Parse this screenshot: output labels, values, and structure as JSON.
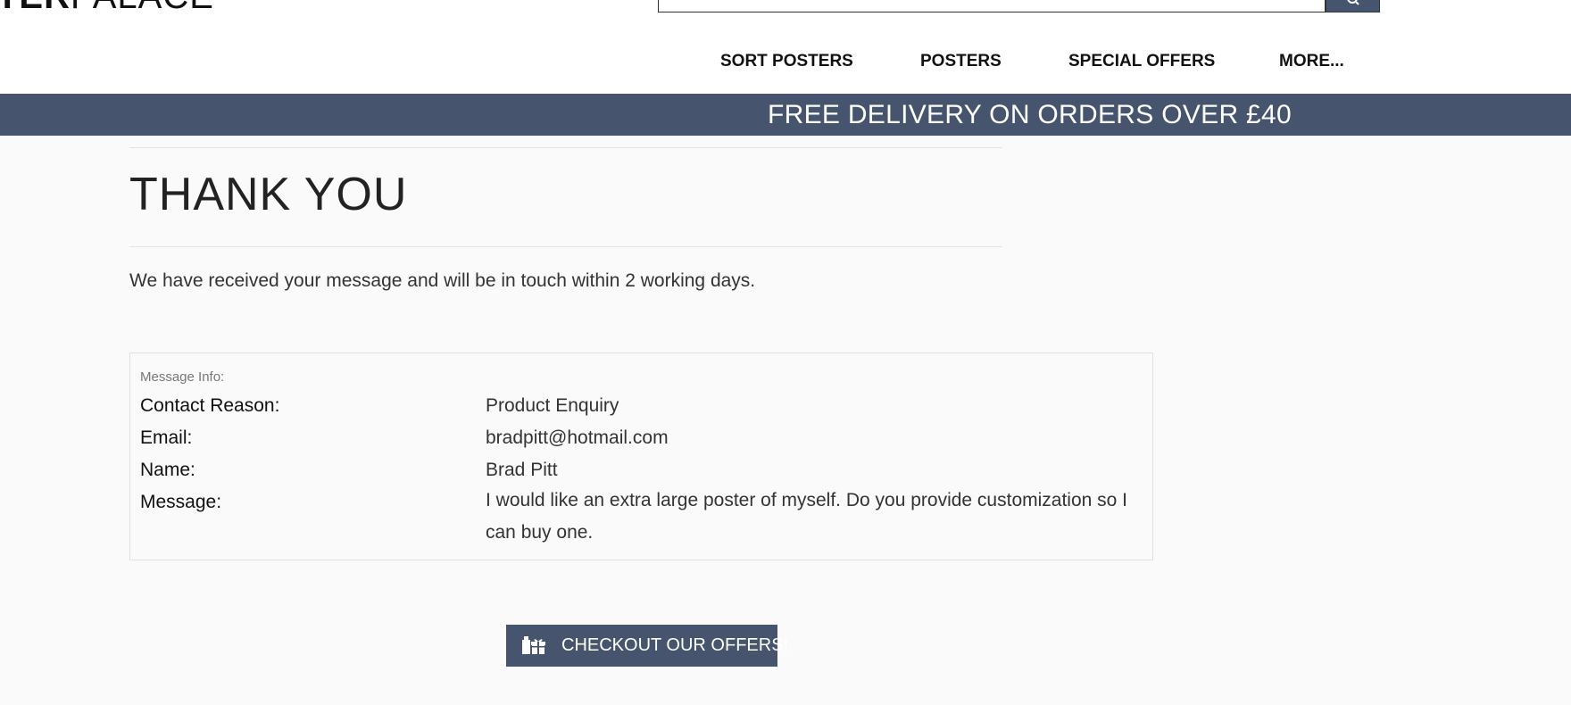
{
  "header": {
    "logo_bold": "TER",
    "logo_light": "PALACE",
    "search_placeholder": ""
  },
  "nav": {
    "items": [
      {
        "label": "SORT POSTERS"
      },
      {
        "label": "POSTERS"
      },
      {
        "label": "SPECIAL OFFERS"
      },
      {
        "label": "MORE..."
      }
    ]
  },
  "banner": {
    "text": "FREE DELIVERY ON ORDERS OVER £40"
  },
  "main": {
    "title": "THANK YOU",
    "lead": "We have received your message and will be in touch within 2 working days.",
    "message_info": {
      "heading": "Message Info:",
      "rows": [
        {
          "label": "Contact Reason:",
          "value": "Product Enquiry"
        },
        {
          "label": "Email:",
          "value": "bradpitt@hotmail.com"
        },
        {
          "label": "Name:",
          "value": "Brad Pitt"
        },
        {
          "label": "Message:",
          "value": "I would like an extra large poster of myself. Do you provide customization so I can buy one."
        }
      ]
    },
    "cta_label": "CHECKOUT OUR OFFERS!"
  },
  "colors": {
    "brand": "#46546e",
    "background": "#fafafa"
  },
  "icons": {
    "search": "search-icon",
    "cta": "gift-icon"
  }
}
